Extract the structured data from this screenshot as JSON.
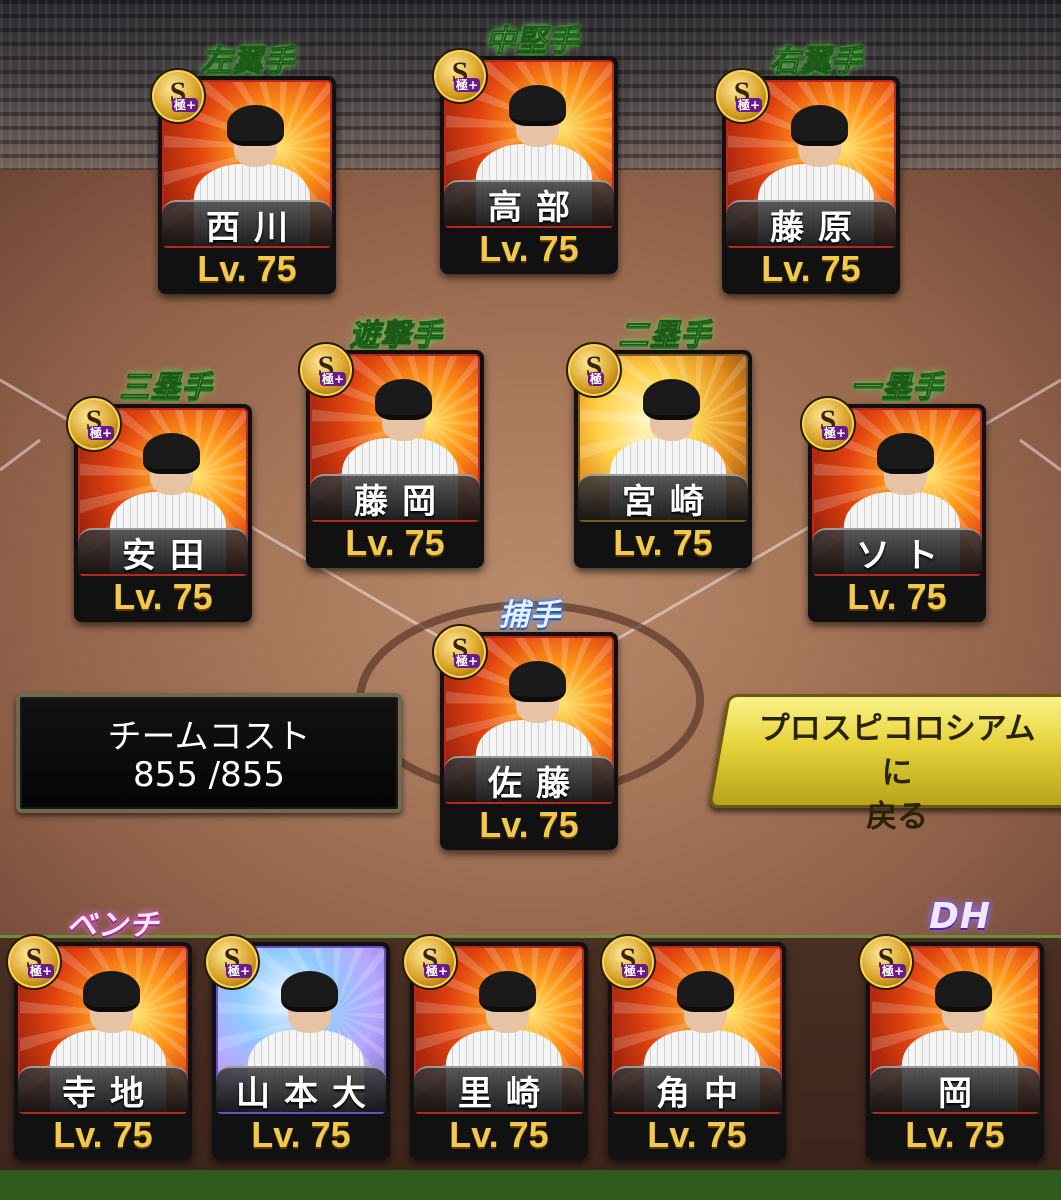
{
  "positions": {
    "left_field": "左翼手",
    "center_field": "中堅手",
    "right_field": "右翼手",
    "shortstop": "遊撃手",
    "second_base": "二塁手",
    "third_base": "三塁手",
    "first_base": "一塁手",
    "catcher": "捕手",
    "bench": "ベンチ",
    "dh": "DH"
  },
  "cards": {
    "left_field": {
      "name": "西川",
      "level": "Lv. 75",
      "rank": "S",
      "tier": "極+"
    },
    "center_field": {
      "name": "高部",
      "level": "Lv. 75",
      "rank": "S",
      "tier": "極+"
    },
    "right_field": {
      "name": "藤原",
      "level": "Lv. 75",
      "rank": "S",
      "tier": "極+"
    },
    "shortstop": {
      "name": "藤岡",
      "level": "Lv. 75",
      "rank": "S",
      "tier": "極+"
    },
    "second_base": {
      "name": "宮崎",
      "level": "Lv. 75",
      "rank": "S",
      "tier": "極"
    },
    "third_base": {
      "name": "安田",
      "level": "Lv. 75",
      "rank": "S",
      "tier": "極+"
    },
    "first_base": {
      "name": "ソト",
      "level": "Lv. 75",
      "rank": "S",
      "tier": "極+"
    },
    "catcher": {
      "name": "佐藤",
      "level": "Lv. 75",
      "rank": "S",
      "tier": "極+"
    },
    "bench": [
      {
        "name": "寺地",
        "level": "Lv. 75",
        "rank": "S",
        "tier": "極+"
      },
      {
        "name": "山本大",
        "level": "Lv. 75",
        "rank": "S",
        "tier": "極+"
      },
      {
        "name": "里崎",
        "level": "Lv. 75",
        "rank": "S",
        "tier": "極+"
      },
      {
        "name": "角中",
        "level": "Lv. 75",
        "rank": "S",
        "tier": "極+"
      }
    ],
    "dh": {
      "name": "岡",
      "level": "Lv. 75",
      "rank": "S",
      "tier": "極+"
    }
  },
  "team_cost": {
    "label": "チームコスト",
    "value": "855 /855"
  },
  "return_button": {
    "line1": "プロスピコロシアムに",
    "line2": "戻る"
  }
}
